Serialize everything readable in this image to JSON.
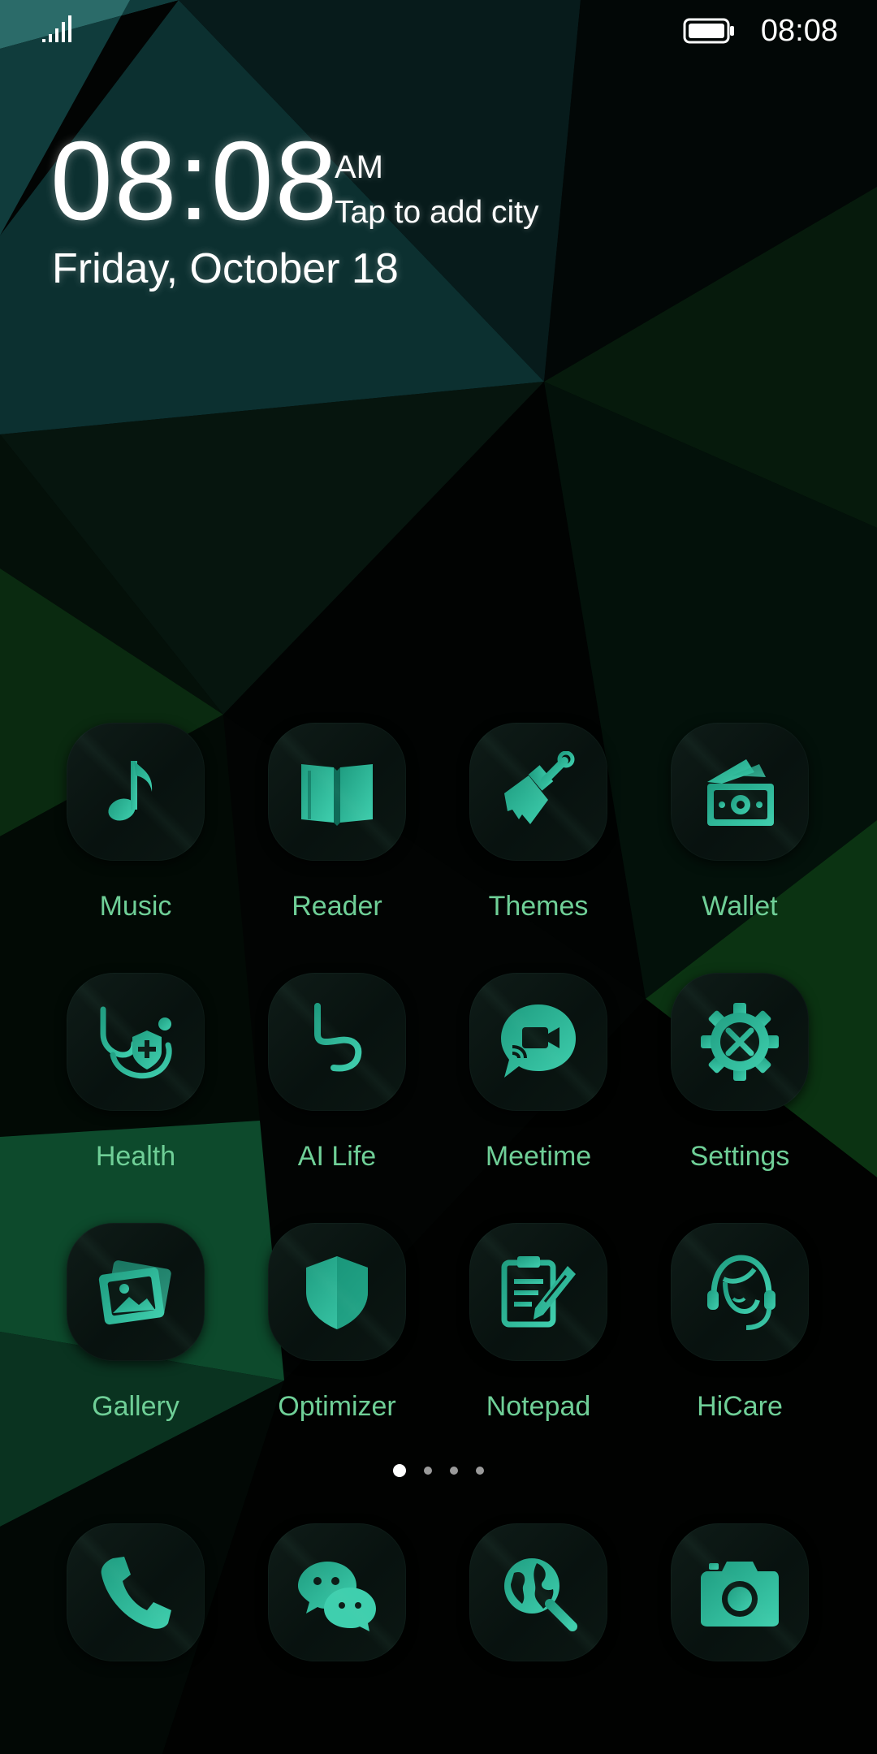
{
  "status_bar": {
    "time": "08:08",
    "signal_icon": "signal-icon",
    "battery_icon": "battery-icon"
  },
  "clock": {
    "time": "08:08",
    "ampm": "AM",
    "city_prompt": "Tap to add city",
    "date": "Friday, October 18"
  },
  "apps": [
    {
      "label": "Music",
      "icon": "music-note-icon"
    },
    {
      "label": "Reader",
      "icon": "book-icon"
    },
    {
      "label": "Themes",
      "icon": "paintbrush-icon"
    },
    {
      "label": "Wallet",
      "icon": "wallet-icon"
    },
    {
      "label": "Health",
      "icon": "stethoscope-icon"
    },
    {
      "label": "AI Life",
      "icon": "ai-life-icon"
    },
    {
      "label": "Meetime",
      "icon": "video-chat-icon"
    },
    {
      "label": "Settings",
      "icon": "gear-icon"
    },
    {
      "label": "Gallery",
      "icon": "photo-icon"
    },
    {
      "label": "Optimizer",
      "icon": "shield-icon"
    },
    {
      "label": "Notepad",
      "icon": "notepad-icon"
    },
    {
      "label": "HiCare",
      "icon": "headset-icon"
    }
  ],
  "page_indicator": {
    "pages": 4,
    "current": 1
  },
  "dock": [
    {
      "icon": "phone-icon"
    },
    {
      "icon": "chat-bubbles-icon"
    },
    {
      "icon": "browser-icon"
    },
    {
      "icon": "camera-icon"
    }
  ],
  "colors": {
    "accent": "#2bb596",
    "accent_light": "#3fcfae",
    "label": "#6fcf97",
    "tile": "#0d1915"
  }
}
